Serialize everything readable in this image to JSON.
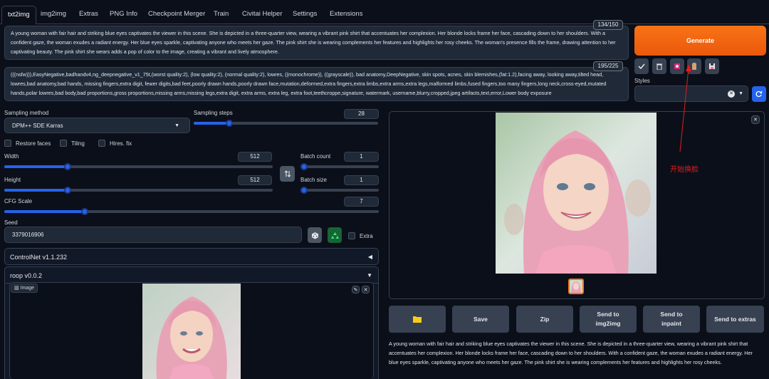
{
  "tabs": [
    "txt2img",
    "img2img",
    "Extras",
    "PNG Info",
    "Checkpoint Merger",
    "Train",
    "Civitai Helper",
    "Settings",
    "Extensions"
  ],
  "prompt": {
    "counter": "134/150",
    "text": "A young woman with fair hair and striking blue eyes captivates the viewer in this scene. She is depicted in a three-quarter view, wearing a vibrant pink shirt that accentuates her complexion. Her blonde locks frame her face, cascading down to her shoulders. With a confident gaze, the woman exudes a radiant energy. Her blue eyes sparkle, captivating anyone who meets her gaze. The pink shirt she is wearing complements her features and highlights her rosy cheeks. The woman's presence fills the frame, drawing attention to her captivating beauty. The pink shirt she wears adds a pop of color to the image, creating a vibrant and lively atmosphere."
  },
  "negative": {
    "counter": "195/225",
    "text": "(((nsfw))),EasyNegative,badhandv4,ng_deepnegative_v1_75t,(worst quality:2), (low quality:2), (normal quality:2), lowres, ((monochrome)), ((grayscale)), bad anatomy,DeepNegative, skin spots, acnes, skin blemishes,(fat:1.2),facing away, looking away,tilted head, lowres,bad anatomy,bad hands, missing fingers,extra digit, fewer digits,bad feet,poorly drawn hands,poorly drawn face,mutation,deformed,extra fingers,extra limbs,extra arms,extra legs,malformed limbs,fused fingers,too many fingers,long neck,cross-eyed,mutated hands,polar lowres,bad body,bad proportions,gross proportions,missing arms,missing legs,extra digit, extra arms, extra leg, extra foot,teethcroppe,signature, watermark, username,blurry,cropped,jpeg artifacts,text,error,Lower body exposure"
  },
  "generate_label": "Generate",
  "styles_label": "Styles",
  "sampling": {
    "method_label": "Sampling method",
    "method_value": "DPM++ SDE Karras",
    "steps_label": "Sampling steps",
    "steps_value": "28",
    "steps_fraction": 0.18
  },
  "options": [
    "Restore faces",
    "Tiling",
    "Hires. fix"
  ],
  "width": {
    "label": "Width",
    "value": "512",
    "fraction": 0.23
  },
  "height": {
    "label": "Height",
    "value": "512",
    "fraction": 0.23
  },
  "batch_count": {
    "label": "Batch count",
    "value": "1",
    "fraction": 0.0
  },
  "batch_size": {
    "label": "Batch size",
    "value": "1",
    "fraction": 0.0
  },
  "cfg": {
    "label": "CFG Scale",
    "value": "7",
    "fraction": 0.21
  },
  "seed": {
    "label": "Seed",
    "value": "3379016906",
    "extra_label": "Extra"
  },
  "controlnet_label": "ControlNet v1.1.232",
  "roop_label": "roop v0.0.2",
  "image_label": "Image",
  "annotation": "开始换脸",
  "actions": [
    "Save",
    "Zip",
    "Send to img2img",
    "Send to inpaint",
    "Send to extras"
  ],
  "output_text": "A young woman with fair hair and striking blue eyes captivates the viewer in this scene. She is depicted in a three-quarter view, wearing a vibrant pink shirt that accentuates her complexion. Her blonde locks frame her face, cascading down to her shoulders. With a confident gaze, the woman exudes a radiant energy. Her blue eyes sparkle, captivating anyone who meets her gaze. The pink shirt she is wearing complements her features and highlights her rosy cheeks.",
  "colors": {
    "accent": "#2563eb",
    "generate": "#f97316",
    "annotation": "#e11d1d"
  },
  "icons": [
    "check-icon",
    "trash-icon",
    "pink-icon",
    "clipboard-icon",
    "save-icon",
    "refresh-icon",
    "dice-icon",
    "recycle-icon",
    "folder-icon",
    "swap-icon",
    "close-icon",
    "pencil-icon"
  ]
}
